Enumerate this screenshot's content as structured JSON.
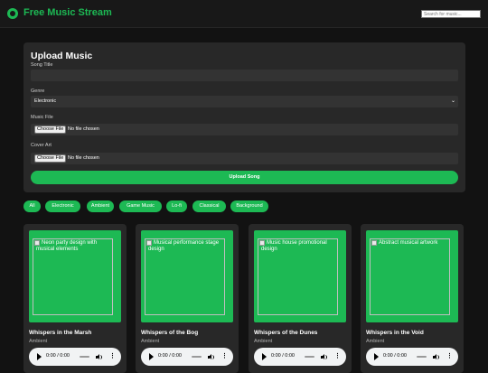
{
  "header": {
    "brand": "Free Music Stream",
    "search_placeholder": "Search for music..."
  },
  "upload": {
    "heading": "Upload Music",
    "song_title_label": "Song Title",
    "song_title_value": "",
    "genre_label": "Genre",
    "genre_selected": "Electronic",
    "music_file_label": "Music File",
    "cover_art_label": "Cover Art",
    "choose_file_label": "Choose File",
    "no_file_text": "No file chosen",
    "submit_label": "Upload Song"
  },
  "filters": [
    "All",
    "Electronic",
    "Ambient",
    "Game Music",
    "Lo-fi",
    "Classical",
    "Background"
  ],
  "cards": [
    {
      "alt": "Neon party design with musical elements",
      "title": "Whispers in the Marsh",
      "genre": "Ambient",
      "time": "0:00 / 0:00"
    },
    {
      "alt": "Musical performance stage design",
      "title": "Whispers of the Bog",
      "genre": "Ambient",
      "time": "0:00 / 0:00"
    },
    {
      "alt": "Music house promotional design",
      "title": "Whispers of the Dunes",
      "genre": "Ambient",
      "time": "0:00 / 0:00"
    },
    {
      "alt": "Abstract musical artwork",
      "title": "Whispers in the Void",
      "genre": "Ambient",
      "time": "0:00 / 0:00"
    }
  ],
  "icons": {
    "logo": "music-disc-icon",
    "play": "play-icon",
    "volume": "volume-icon",
    "more": "more-options-icon",
    "broken_image": "broken-image-icon"
  },
  "colors": {
    "accent": "#1db954",
    "background": "#121212",
    "panel": "#282828",
    "field": "#333333"
  }
}
